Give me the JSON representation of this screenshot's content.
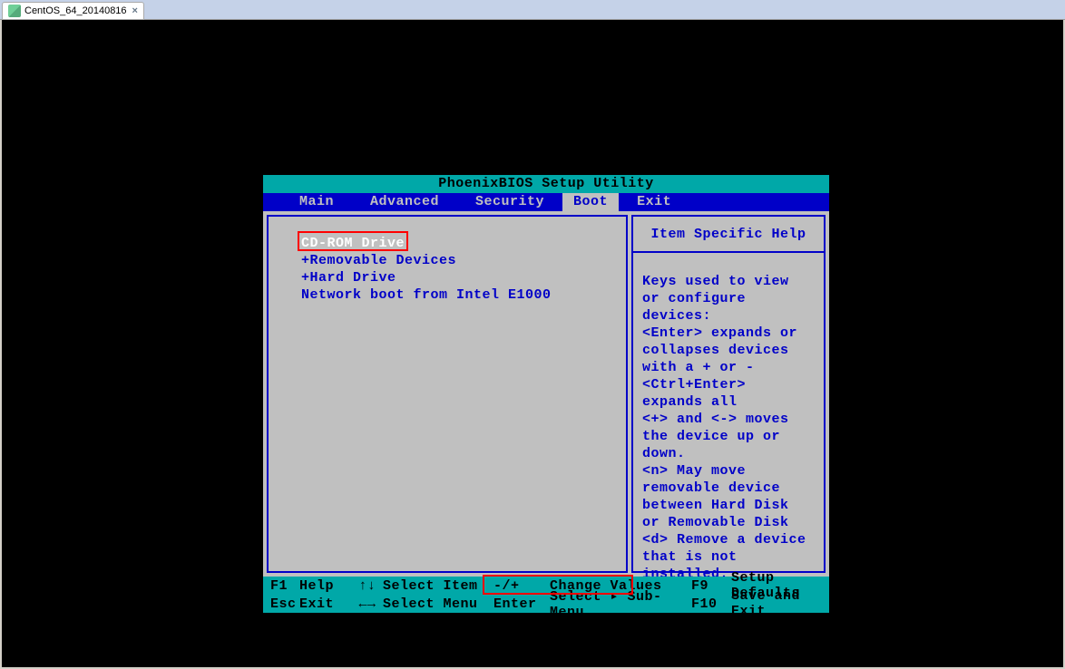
{
  "window": {
    "tab_title": "CentOS_64_20140816"
  },
  "bios": {
    "title": "PhoenixBIOS Setup Utility",
    "menu": {
      "items": [
        "Main",
        "Advanced",
        "Security",
        "Boot",
        "Exit"
      ],
      "selected_index": 3
    },
    "boot_order": [
      {
        "label": "CD-ROM Drive",
        "prefix": " ",
        "selected": true
      },
      {
        "label": "Removable Devices",
        "prefix": "+",
        "selected": false
      },
      {
        "label": "Hard Drive",
        "prefix": "+",
        "selected": false
      },
      {
        "label": "Network boot from Intel E1000",
        "prefix": " ",
        "selected": false
      }
    ],
    "help": {
      "header": "Item Specific Help",
      "body": "Keys used to view or configure devices:\n<Enter> expands or collapses devices with a + or -\n<Ctrl+Enter> expands all\n<+> and <-> moves the device up or down.\n<n> May move removable device between Hard Disk or Removable Disk\n<d> Remove a device that is not installed."
    },
    "footer": {
      "row1": {
        "k1": "F1",
        "l1": "Help",
        "arrows1": "↑↓",
        "a1": "Select Item",
        "k2": "-/+",
        "a2": "Change Values",
        "k3": "F9",
        "a3": "Setup Defaults"
      },
      "row2": {
        "k1": "Esc",
        "l1": "Exit",
        "arrows1": "←→",
        "a1": "Select Menu",
        "k2": "Enter",
        "a2": "Select ▸ Sub-Menu",
        "k3": "F10",
        "a3": "Save and Exit"
      }
    }
  }
}
